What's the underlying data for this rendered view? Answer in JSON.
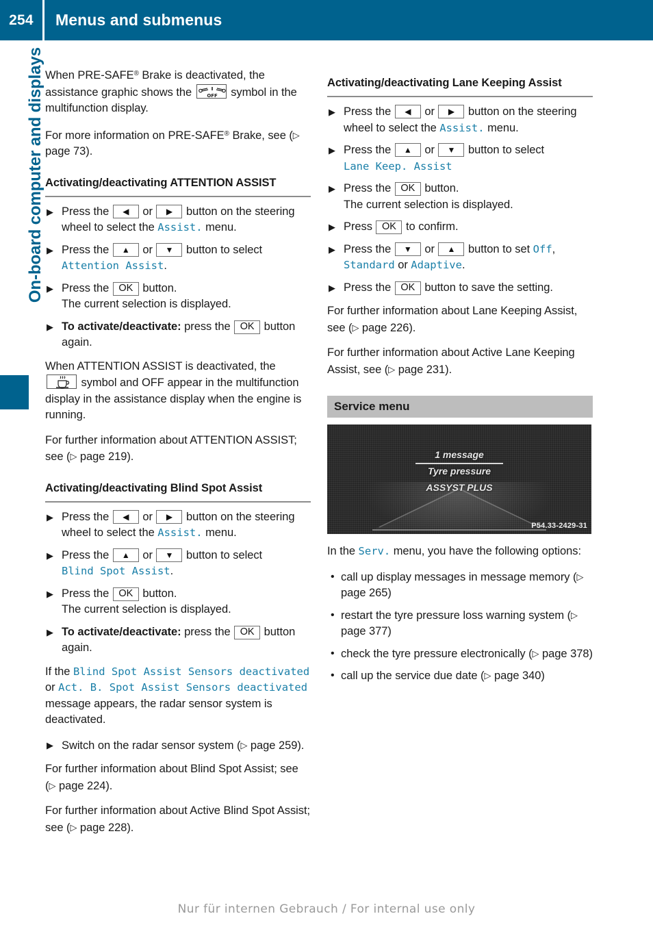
{
  "header": {
    "page_number": "254",
    "title": "Menus and submenus",
    "bg_color": "#00628e"
  },
  "side_tab": {
    "label": "On-board computer and displays",
    "color": "#00628e"
  },
  "left_column": {
    "intro_para_1": {
      "t1": "When PRE-SAFE",
      "reg": "®",
      "t2": " Brake is deactivated, the assistance graphic shows the ",
      "symbol": "presafe-brake-off-icon",
      "t3": " symbol in the multifunction display."
    },
    "intro_para_2": {
      "t1": "For more information on PRE-SAFE",
      "reg": "®",
      "t2": " Brake, see (",
      "ref_arrow": "▷",
      "t3": " page 73)."
    },
    "attention_heading": "Activating/deactivating ATTENTION ASSIST",
    "attention_steps": [
      {
        "t1": "Press the ",
        "key1": "◀",
        "t2": " or ",
        "key2": "▶",
        "t3": " button on the steering wheel to select the ",
        "mono": "Assist.",
        "t4": " menu."
      },
      {
        "t1": "Press the ",
        "key1": "▲",
        "t2": " or ",
        "key2": "▼",
        "t3": " button to select ",
        "mono": "Attention Assist",
        "t4": "."
      },
      {
        "t1": "Press the ",
        "key1": "OK",
        "t2": " button.",
        "sub": "The current selection is displayed."
      },
      {
        "bold": "To activate/deactivate:",
        "t1": " press the ",
        "key1": "OK",
        "t2": " button again."
      }
    ],
    "attention_para_1": {
      "t1": "When ATTENTION ASSIST is deactivated, the ",
      "symbol": "coffee-cup-icon",
      "t2": " symbol and OFF appear in the multifunction display in the assistance display when the engine is running."
    },
    "attention_para_2": {
      "t1": "For further information about ATTENTION ASSIST; see (",
      "ref_arrow": "▷",
      "t2": " page 219)."
    },
    "blindspot_heading": "Activating/deactivating Blind Spot Assist",
    "blindspot_steps": [
      {
        "t1": "Press the ",
        "key1": "◀",
        "t2": " or ",
        "key2": "▶",
        "t3": " button on the steering wheel to select the ",
        "mono": "Assist.",
        "t4": " menu."
      },
      {
        "t1": "Press the ",
        "key1": "▲",
        "t2": " or ",
        "key2": "▼",
        "t3": " button to select ",
        "mono": "Blind Spot Assist",
        "t4": "."
      },
      {
        "t1": "Press the ",
        "key1": "OK",
        "t2": " button.",
        "sub": "The current selection is displayed."
      },
      {
        "bold": "To activate/deactivate:",
        "t1": " press the ",
        "key1": "OK",
        "t2": " button again."
      }
    ],
    "blindspot_para_1": {
      "t1": "If the ",
      "mono1": "Blind Spot Assist Sensors deactivated",
      "t2": " or ",
      "mono2": "Act. B. Spot Assist Sensors deactivated",
      "t3": " message appears, the radar sensor system is deactivated."
    },
    "blindspot_step_switch": {
      "t1": "Switch on the radar sensor system (",
      "ref_arrow": "▷",
      "t2": " page 259)."
    },
    "blindspot_para_2": {
      "t1": "For further information about Blind Spot Assist; see (",
      "ref_arrow": "▷",
      "t2": " page 224)."
    },
    "blindspot_para_3": {
      "t1": "For further information about Active Blind Spot Assist; see (",
      "ref_arrow": "▷",
      "t2": " page 228)."
    }
  },
  "right_column": {
    "lane_heading": "Activating/deactivating Lane Keeping Assist",
    "lane_steps": [
      {
        "t1": "Press the ",
        "key1": "◀",
        "t2": " or ",
        "key2": "▶",
        "t3": " button on the steering wheel to select the ",
        "mono": "Assist.",
        "t4": " menu."
      },
      {
        "t1": "Press the ",
        "key1": "▲",
        "t2": " or ",
        "key2": "▼",
        "t3": " button to select ",
        "mono": "Lane Keep. Assist",
        "t4": ""
      },
      {
        "t1": "Press the ",
        "key1": "OK",
        "t2": " button.",
        "sub": "The current selection is displayed."
      },
      {
        "t1": "Press ",
        "key1": "OK",
        "t2": " to confirm."
      },
      {
        "t1": "Press the ",
        "key1": "▼",
        "t2": " or ",
        "key2": "▲",
        "t3": " button to set ",
        "mono": "Off",
        "t4": ", ",
        "mono2": "Standard",
        "t5": " or ",
        "mono3": "Adaptive",
        "t6": "."
      },
      {
        "t1": "Press the ",
        "key1": "OK",
        "t2": " button to save the setting."
      }
    ],
    "lane_para_1": {
      "t1": "For further information about Lane Keeping Assist, see (",
      "ref_arrow": "▷",
      "t2": " page 226)."
    },
    "lane_para_2": {
      "t1": "For further information about Active Lane Keeping Assist, see (",
      "ref_arrow": "▷",
      "t2": " page 231)."
    },
    "service_heading": "Service menu",
    "service_screenshot": {
      "line_1": "1 message",
      "line_2": "Tyre pressure",
      "line_3": "ASSYST PLUS",
      "code": "P54.33-2429-31"
    },
    "service_intro": {
      "t1": "In the ",
      "mono": "Serv.",
      "t2": " menu, you have the following options:"
    },
    "service_options": [
      {
        "t1": "call up display messages in message memory (",
        "ref_arrow": "▷",
        "t2": " page 265)"
      },
      {
        "t1": "restart the tyre pressure loss warning system (",
        "ref_arrow": "▷",
        "t2": " page 377)"
      },
      {
        "t1": "check the tyre pressure electronically (",
        "ref_arrow": "▷",
        "t2": " page 378)"
      },
      {
        "t1": "call up the service due date (",
        "ref_arrow": "▷",
        "t2": " page 340)"
      }
    ]
  },
  "footer": {
    "text": "Nur für internen Gebrauch / For internal use only"
  }
}
